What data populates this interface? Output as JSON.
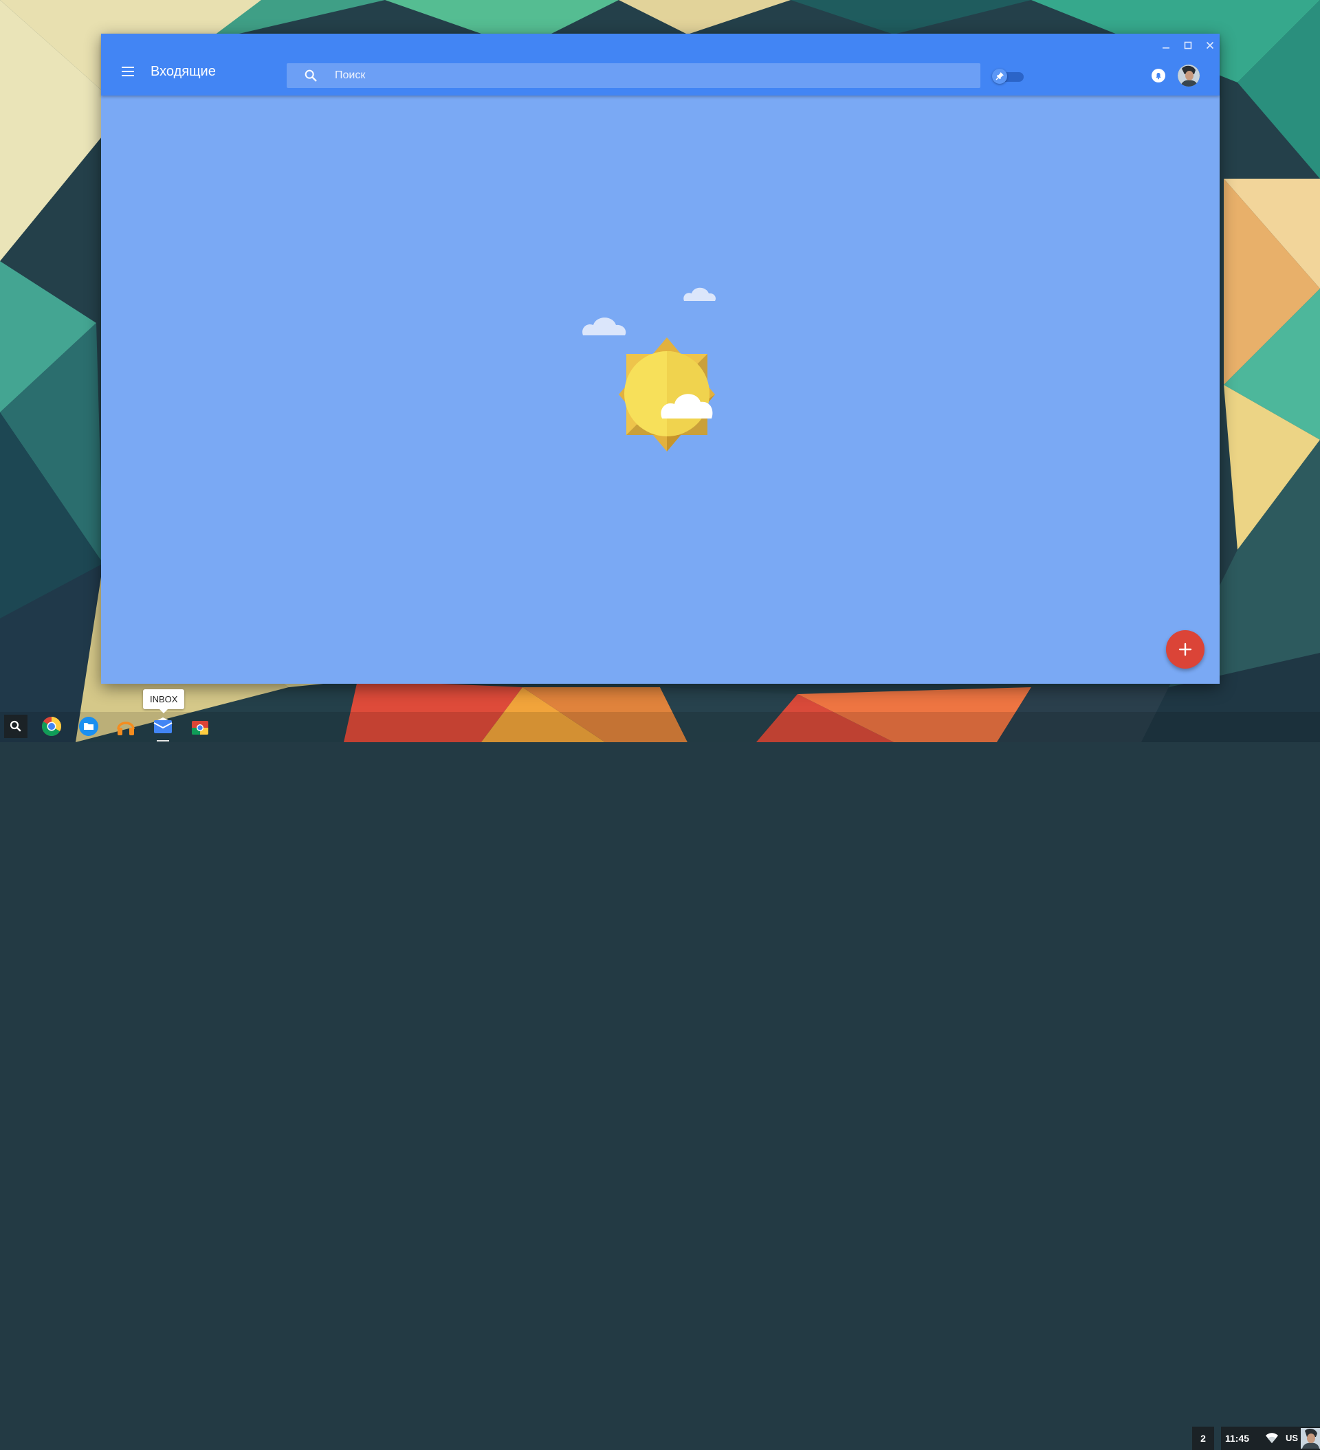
{
  "window": {
    "title": "Входящие",
    "search": {
      "placeholder": "Поиск",
      "value": ""
    },
    "controls": [
      "minimize",
      "maximize",
      "close"
    ],
    "colors": {
      "appbar": "#4285f4",
      "content": "#7aa9f4",
      "compose": "#db4437"
    }
  },
  "icons": {
    "menu": "menu-icon",
    "search": "search-icon",
    "pin": "pin-icon",
    "bell": "bell-icon",
    "compose": "plus-icon"
  },
  "shelf": {
    "apps": [
      "chrome",
      "files",
      "google-play-music",
      "inbox",
      "chrome-web-store"
    ],
    "tooltip": "INBOX",
    "desk_count": "2",
    "clock": "11:45",
    "ime": "US"
  }
}
